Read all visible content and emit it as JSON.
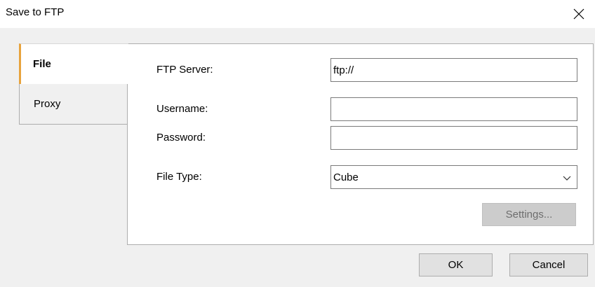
{
  "window": {
    "title": "Save to FTP",
    "close_icon": "close-icon"
  },
  "tabs": [
    {
      "label": "File",
      "active": true
    },
    {
      "label": "Proxy",
      "active": false
    }
  ],
  "form": {
    "ftp_server": {
      "label": "FTP Server:",
      "value": "ftp://"
    },
    "username": {
      "label": "Username:",
      "value": ""
    },
    "password": {
      "label": "Password:",
      "value": ""
    },
    "file_type": {
      "label": "File Type:",
      "selected": "Cube"
    },
    "settings_button": "Settings..."
  },
  "footer": {
    "ok_label": "OK",
    "cancel_label": "Cancel"
  },
  "colors": {
    "active_tab_accent": "#e8a33d"
  }
}
